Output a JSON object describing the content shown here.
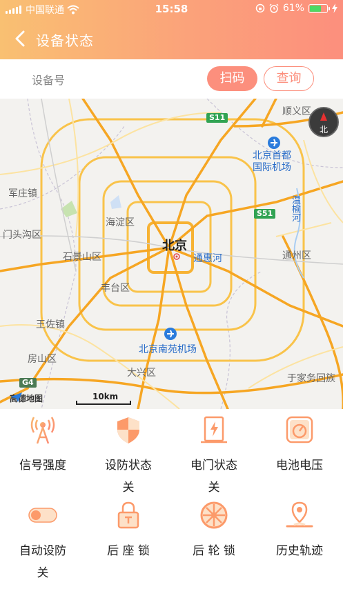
{
  "status_bar": {
    "carrier": "中国联通",
    "time": "15:58",
    "battery": "61%",
    "battery_level": 0.61
  },
  "nav": {
    "title": "设备状态"
  },
  "device_bar": {
    "label": "设备号",
    "scan_label": "扫码",
    "query_label": "查询"
  },
  "map": {
    "labels": {
      "shunyi": "顺义区",
      "airport": "北京首都\n国际机场",
      "junzhuang": "军庄镇",
      "haidian": "海淀区",
      "mentougou": "门头沟区",
      "beijing": "北京",
      "tonghuihe": "通惠河",
      "shijingshan": "石景山区",
      "tongzhou": "通州区",
      "fengtai": "丰台区",
      "wangzuo": "王佐镇",
      "nanyuan": "北京南苑机场",
      "fangshan": "房山区",
      "daxing": "大兴区",
      "yujiawu": "于家务回族",
      "wenyuhe": "温榆河"
    },
    "road_signs": {
      "s11": "S11",
      "s51": "S51",
      "g4": "G4"
    },
    "compass": "北",
    "scale": "10km",
    "logo": "高德地图"
  },
  "controls": [
    {
      "label": "信号强度",
      "icon": "signal-tower-icon"
    },
    {
      "label": "设防状态\n关",
      "icon": "shield-icon"
    },
    {
      "label": "电门状态\n关",
      "icon": "power-switch-icon"
    },
    {
      "label": "电池电压",
      "icon": "battery-gauge-icon"
    },
    {
      "label": "自动设防\n关",
      "icon": "toggle-icon"
    },
    {
      "label": "后 座 锁",
      "icon": "lock-icon"
    },
    {
      "label": "后 轮 锁",
      "icon": "wheel-icon"
    },
    {
      "label": "历史轨迹",
      "icon": "location-pin-icon"
    }
  ],
  "colors": {
    "accent": "#fc8f7d",
    "header_start": "#f9c072",
    "header_end": "#fc8f7d"
  }
}
